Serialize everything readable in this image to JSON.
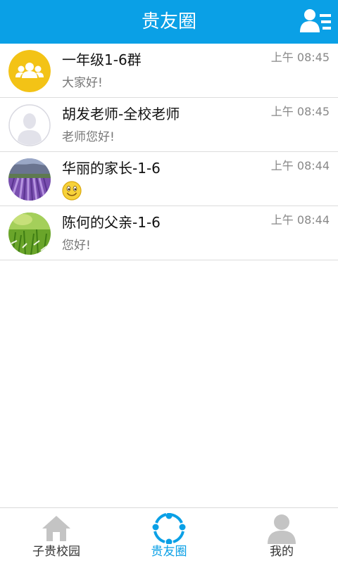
{
  "header": {
    "title": "贵友圈",
    "contacts_icon": "contacts-list-icon",
    "bg_color": "#0aa0e6"
  },
  "chats": [
    {
      "name": "一年级1-6群",
      "time": "上午 08:45",
      "preview": "大家好!",
      "avatar": "group-avatar-icon"
    },
    {
      "name": "胡发老师-全校老师",
      "time": "上午 08:45",
      "preview": "老师您好!",
      "avatar": "default-person-avatar"
    },
    {
      "name": "华丽的家长-1-6",
      "time": "上午 08:44",
      "preview": "",
      "preview_icon": "smiley-emoji-icon",
      "avatar": "lavender-field-photo"
    },
    {
      "name": "陈何的父亲-1-6",
      "time": "上午 08:44",
      "preview": "您好!",
      "avatar": "grass-field-photo"
    }
  ],
  "nav": {
    "items": [
      {
        "label": "子贵校园",
        "icon": "home-icon",
        "active": false
      },
      {
        "label": "贵友圈",
        "icon": "circle-share-icon",
        "active": true
      },
      {
        "label": "我的",
        "icon": "person-icon",
        "active": false
      }
    ]
  }
}
